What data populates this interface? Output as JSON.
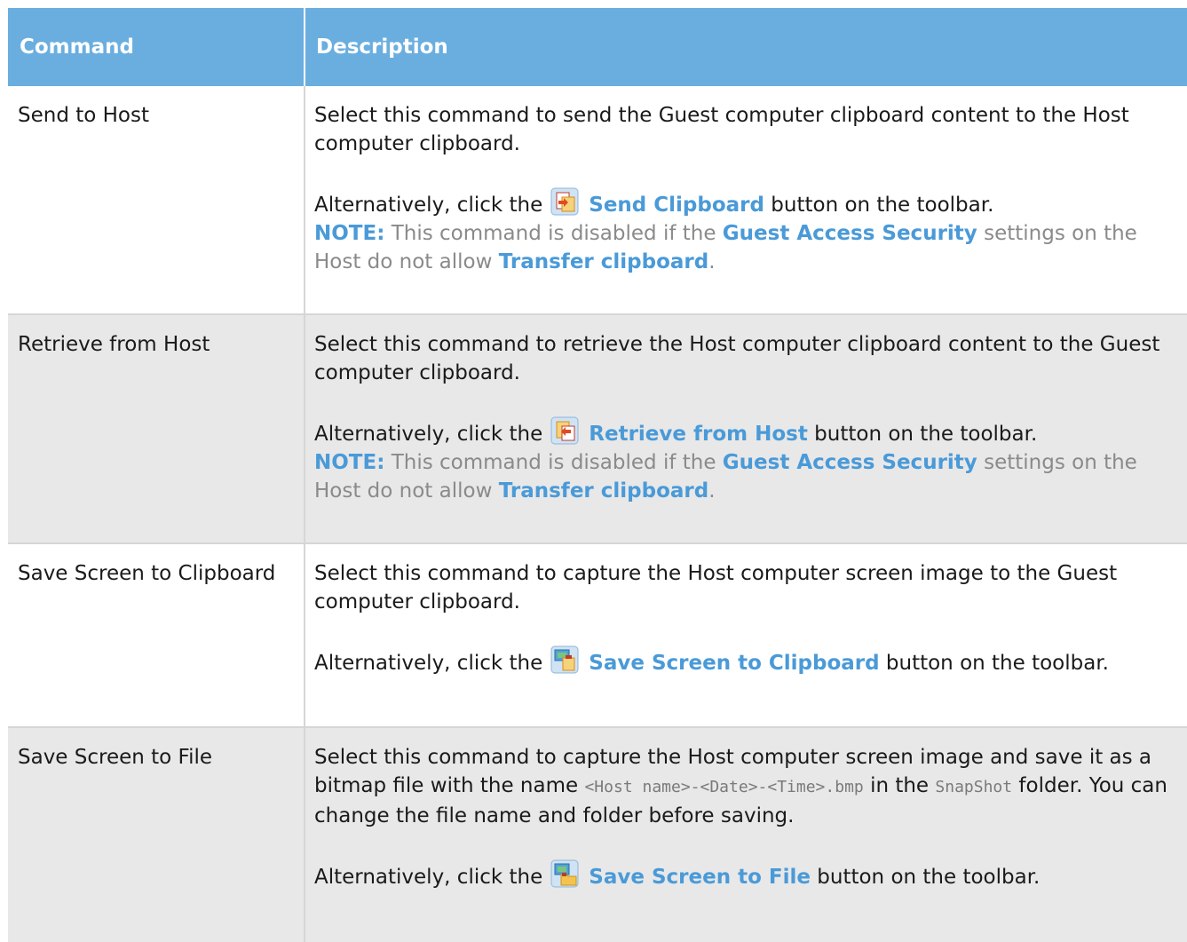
{
  "table": {
    "headers": {
      "command": "Command",
      "description": "Description"
    },
    "rows": [
      {
        "command": "Send to Host",
        "description": "Select this command to send the Guest computer clipboard content to the Host computer clipboard.",
        "alt_prefix": "Alternatively, click the",
        "button_icon": "send-clipboard-icon",
        "button_label": "Send Clipboard",
        "alt_suffix": "button on the toolbar.",
        "note_label": "NOTE:",
        "note_text_1": "This command is disabled if the",
        "note_link_1": "Guest Access Security",
        "note_text_2": "settings on the Host do not allow",
        "note_link_2": "Transfer clipboard",
        "note_end": "."
      },
      {
        "command": "Retrieve from Host",
        "description": "Select this command to retrieve the Host computer clipboard content to the Guest computer clipboard.",
        "alt_prefix": "Alternatively, click the",
        "button_icon": "retrieve-clipboard-icon",
        "button_label": "Retrieve from Host",
        "alt_suffix": "button on the toolbar.",
        "note_label": "NOTE:",
        "note_text_1": "This command is disabled if the",
        "note_link_1": "Guest Access Security",
        "note_text_2": "settings on the Host do not allow",
        "note_link_2": "Transfer clipboard",
        "note_end": "."
      },
      {
        "command": "Save Screen to Clipboard",
        "description": "Select this command to capture the Host computer screen image to the Guest computer clipboard.",
        "alt_prefix": "Alternatively, click the",
        "button_icon": "save-screen-clipboard-icon",
        "button_label": "Save Screen to Clipboard",
        "alt_suffix": "button on the toolbar."
      },
      {
        "command": "Save Screen to File",
        "description_1": "Select this command to capture the Host computer screen image and save it as a bitmap file with the name",
        "filename": "<Host name>-<Date>-<Time>.bmp",
        "description_2": "in the",
        "folder": "SnapShot",
        "description_3": "folder. You can change the file name and folder before saving.",
        "alt_prefix": "Alternatively, click the",
        "button_icon": "save-screen-file-icon",
        "button_label": "Save Screen to File",
        "alt_suffix": "button on the toolbar."
      }
    ]
  },
  "colors": {
    "header_bg": "#6aaee0",
    "link": "#4a9ad8",
    "note_text": "#8a8a8a",
    "alt_row_bg": "#e8e8e8"
  }
}
